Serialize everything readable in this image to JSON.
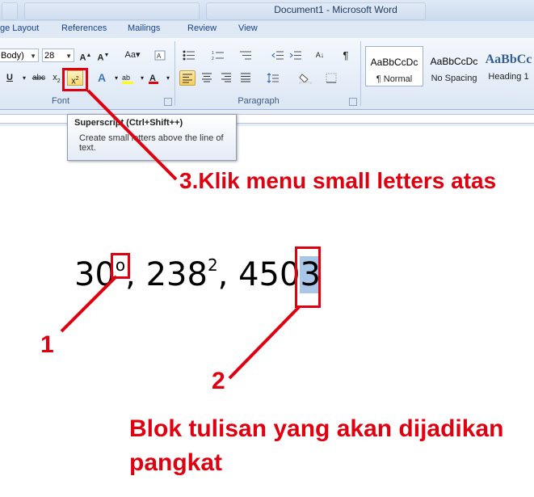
{
  "window": {
    "title": "Document1 - Microsoft Word"
  },
  "ribbon_tabs": [
    "ge Layout",
    "References",
    "Mailings",
    "Review",
    "View"
  ],
  "font_group": {
    "font_name": "Body)",
    "font_size": "28",
    "label": "Font"
  },
  "paragraph_group": {
    "label": "Paragraph"
  },
  "styles": [
    {
      "sample": "AaBbCcDc",
      "name": "¶ Normal"
    },
    {
      "sample": "AaBbCcDc",
      "name": "No Spacing"
    },
    {
      "sample": "AaBbCc",
      "name": "Heading 1"
    }
  ],
  "tooltip": {
    "title": "Superscript (Ctrl+Shift++)",
    "description": "Create small letters above the line of text."
  },
  "document": {
    "part1": "30",
    "sup1": "o",
    "part2": ", 238",
    "sup2": "2",
    "part3": ", 450",
    "selected": "3"
  },
  "annotations": {
    "step3": "3.Klik menu small letters atas",
    "step1": "1",
    "step2": "2",
    "note": "Blok tulisan yang akan dijadikan pangkat"
  },
  "colors": {
    "annotation_red": "#e00010",
    "selection": "#a9c6e8",
    "ribbon": "#dbe6f4"
  }
}
